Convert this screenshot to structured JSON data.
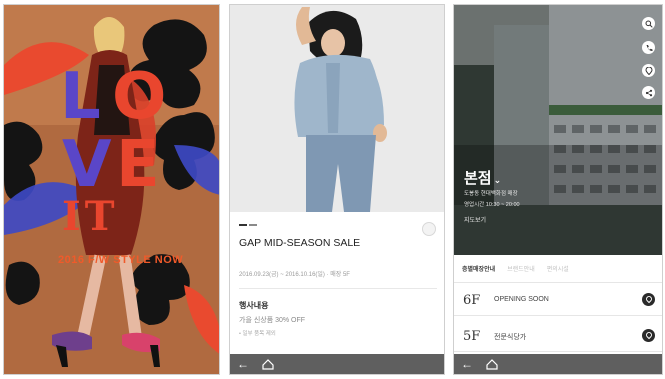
{
  "panel1": {
    "love_letters": [
      "L",
      "O",
      "V",
      "E"
    ],
    "it_text": "IT",
    "style_now": "2016 F/W STYLE NOW"
  },
  "panel2": {
    "tags": [
      "",
      ""
    ],
    "title": "GAP MID-SEASON SALE",
    "date": "2016.09.23(금) ~ 2016.10.16(일) · 매장 5F",
    "event_heading": "행사내용",
    "event_desc": "가을 신상품 30% OFF",
    "event_note": "• 일부 품목 제외",
    "nav": {
      "back": "←"
    }
  },
  "panel3": {
    "store_name": "본점",
    "chevron": "⌄",
    "address": "도봉동 현대백화점 매장",
    "hours": "영업시간 10:30 ~ 20:00",
    "link": "지도보기",
    "tabs": [
      "층별매장안내",
      "브랜드안내",
      "편의시설"
    ],
    "floors": [
      {
        "num": "6F",
        "label": "OPENING SOON"
      },
      {
        "num": "5F",
        "label": "전문식당가"
      }
    ],
    "fab_icons": [
      "search-icon",
      "phone-icon",
      "location-pin-icon",
      "share-icon"
    ],
    "nav": {
      "back": "←"
    }
  }
}
